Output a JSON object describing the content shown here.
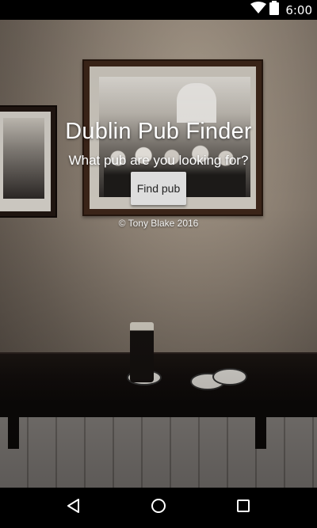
{
  "status_bar": {
    "time": "6:00",
    "icons": [
      "wifi-icon",
      "battery-icon"
    ]
  },
  "main": {
    "title": "Dublin Pub Finder",
    "subtitle": "What pub are you looking for?",
    "find_button_label": "Find pub",
    "copyright": "© Tony Blake 2016"
  },
  "nav_bar": {
    "buttons": [
      "back-icon",
      "home-icon",
      "recents-icon"
    ]
  },
  "colors": {
    "status_bar_bg": "#000000",
    "nav_bar_bg": "#000000",
    "button_bg": "#dddddd",
    "text": "#ffffff"
  }
}
